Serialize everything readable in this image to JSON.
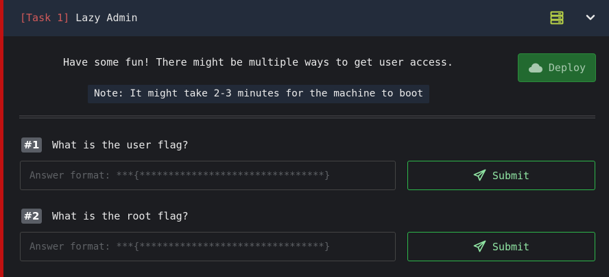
{
  "header": {
    "task_tag": "[Task 1]",
    "task_name": "Lazy Admin",
    "icons": [
      "server-icon",
      "chevron-down-icon"
    ]
  },
  "content": {
    "description": "Have some fun! There might be multiple ways to get user access.",
    "note": "Note: It might take 2-3 minutes for the machine to boot"
  },
  "deploy": {
    "label": "Deploy",
    "icon": "cloud-icon"
  },
  "questions": [
    {
      "number": "#1",
      "text": "What is the user flag?",
      "placeholder": "Answer format: ***{********************************}",
      "value": "",
      "submit_label": "Submit"
    },
    {
      "number": "#2",
      "text": "What is the root flag?",
      "placeholder": "Answer format: ***{********************************}",
      "value": "",
      "submit_label": "Submit"
    }
  ],
  "colors": {
    "accent": "#c11111",
    "header_bg": "#232c3b",
    "task_tag": "#d15a5a",
    "deploy_bg": "#226a30",
    "submit_border": "#2db84b",
    "submit_text": "#8fe3a2",
    "server_icon": "#b9d247"
  }
}
